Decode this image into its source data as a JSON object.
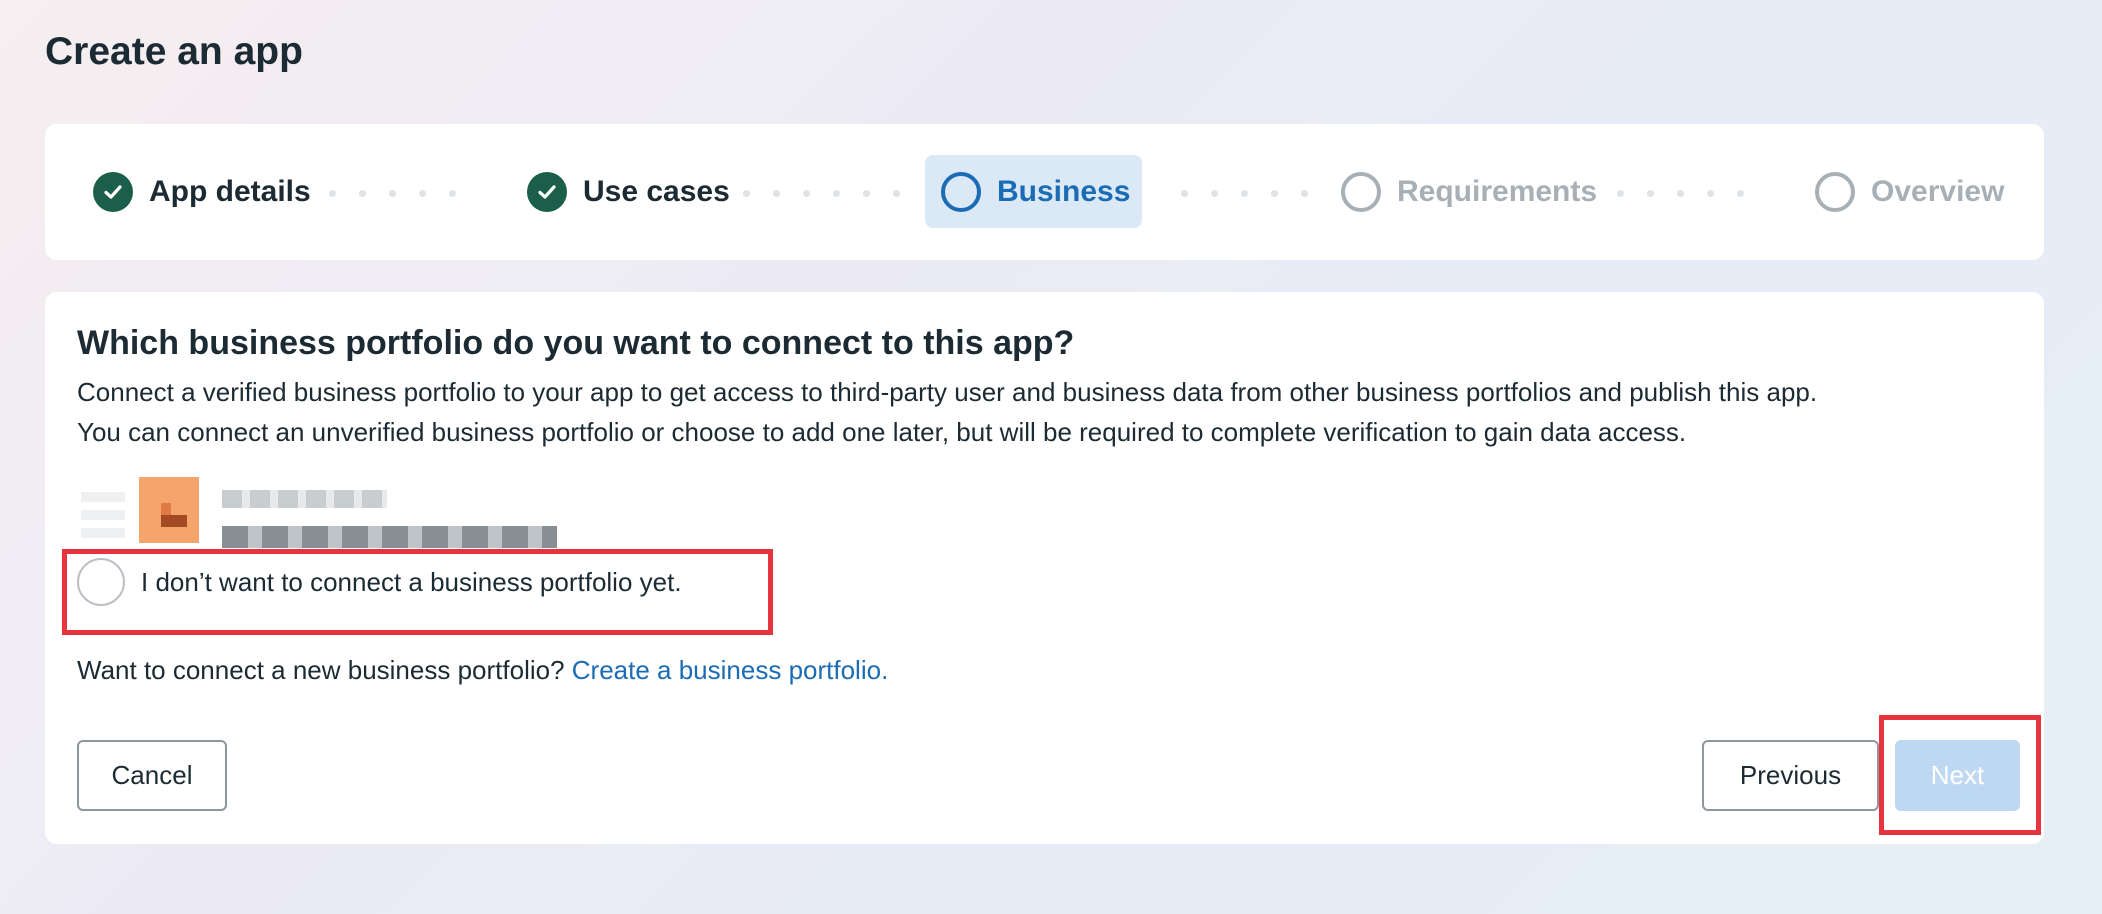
{
  "page": {
    "title": "Create an app"
  },
  "stepper": {
    "steps": [
      {
        "label": "App details",
        "state": "done"
      },
      {
        "label": "Use cases",
        "state": "done"
      },
      {
        "label": "Business",
        "state": "current"
      },
      {
        "label": "Requirements",
        "state": "todo"
      },
      {
        "label": "Overview",
        "state": "todo"
      }
    ]
  },
  "card": {
    "title": "Which business portfolio do you want to connect to this app?",
    "description_line1": "Connect a verified business portfolio to your app to get access to third-party user and business data from other business portfolios and publish this app.",
    "description_line2": "You can connect an unverified business portfolio or choose to add one later, but will be required to complete verification to gain data access.",
    "option_no_portfolio": "I don’t want to connect a business portfolio yet.",
    "connect_prompt": "Want to connect a new business portfolio?",
    "create_link": "Create a business portfolio."
  },
  "buttons": {
    "cancel": "Cancel",
    "previous": "Previous",
    "next": "Next"
  },
  "colors": {
    "done": "#1b5e49",
    "current": "#1b6bb5",
    "todo": "#a7b0b6",
    "highlight": "#e8343f",
    "next_disabled": "#bfd8f1"
  }
}
